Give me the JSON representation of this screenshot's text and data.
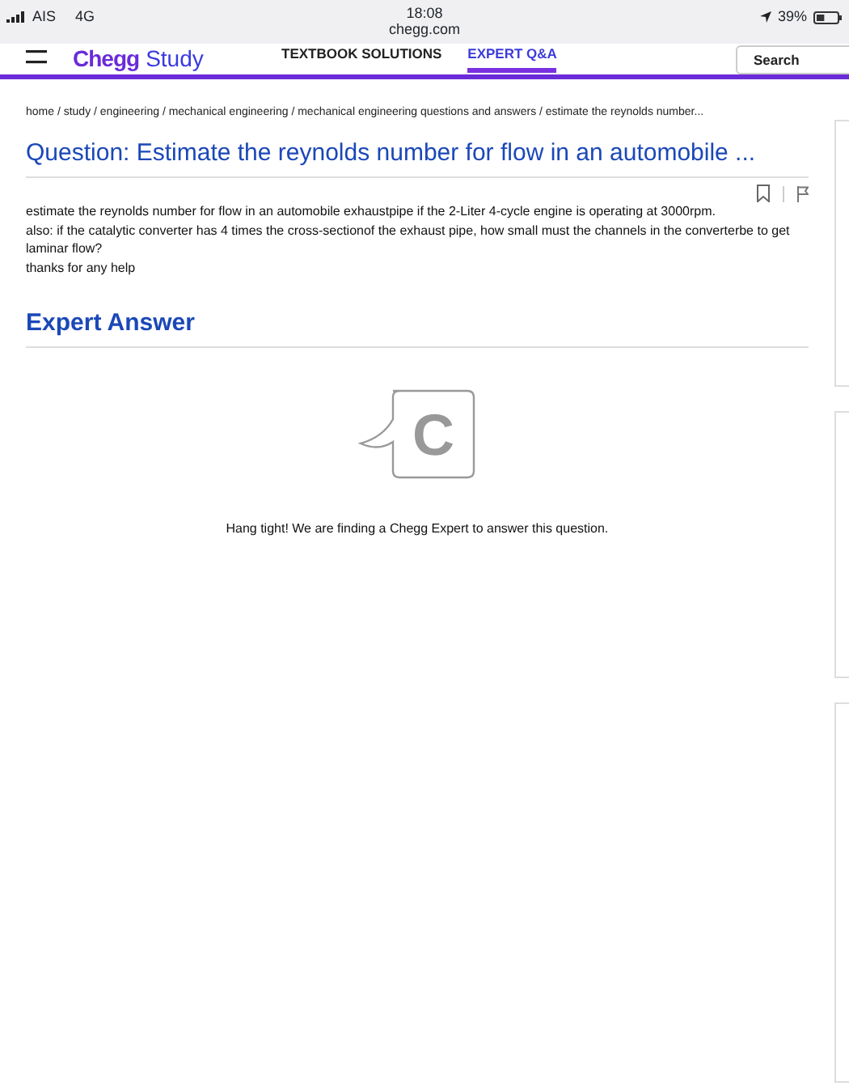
{
  "status_bar": {
    "carrier": "AIS",
    "network": "4G",
    "time": "18:08",
    "url": "chegg.com",
    "battery": "39%"
  },
  "header": {
    "logo_brand": "Chegg",
    "logo_product": "Study",
    "search": {
      "placeholder": "Search"
    },
    "tabs": [
      {
        "label": "TEXTBOOK SOLUTIONS",
        "selected": false
      },
      {
        "label": "EXPERT Q&A",
        "selected": true
      }
    ]
  },
  "breadcrumb": "home / study / engineering / mechanical engineering / mechanical engineering questions and answers / estimate the reynolds number...",
  "question": {
    "title": "Question: Estimate the reynolds number for flow in an automobile ...",
    "bookmarked": false,
    "body": [
      "estimate the reynolds number for flow in an automobile exhaustpipe if the 2-Liter 4-cycle engine is operating at 3000rpm.",
      "also: if the catalytic converter has 4 times the cross-sectionof the exhaust pipe, how small must the channels in the converterbe to get laminar flow?",
      "thanks for any help"
    ]
  },
  "answer": {
    "heading": "Expert Answer",
    "logo_letter": "C",
    "message": "Hang tight! We are finding a Chegg Expert to answer this question."
  }
}
